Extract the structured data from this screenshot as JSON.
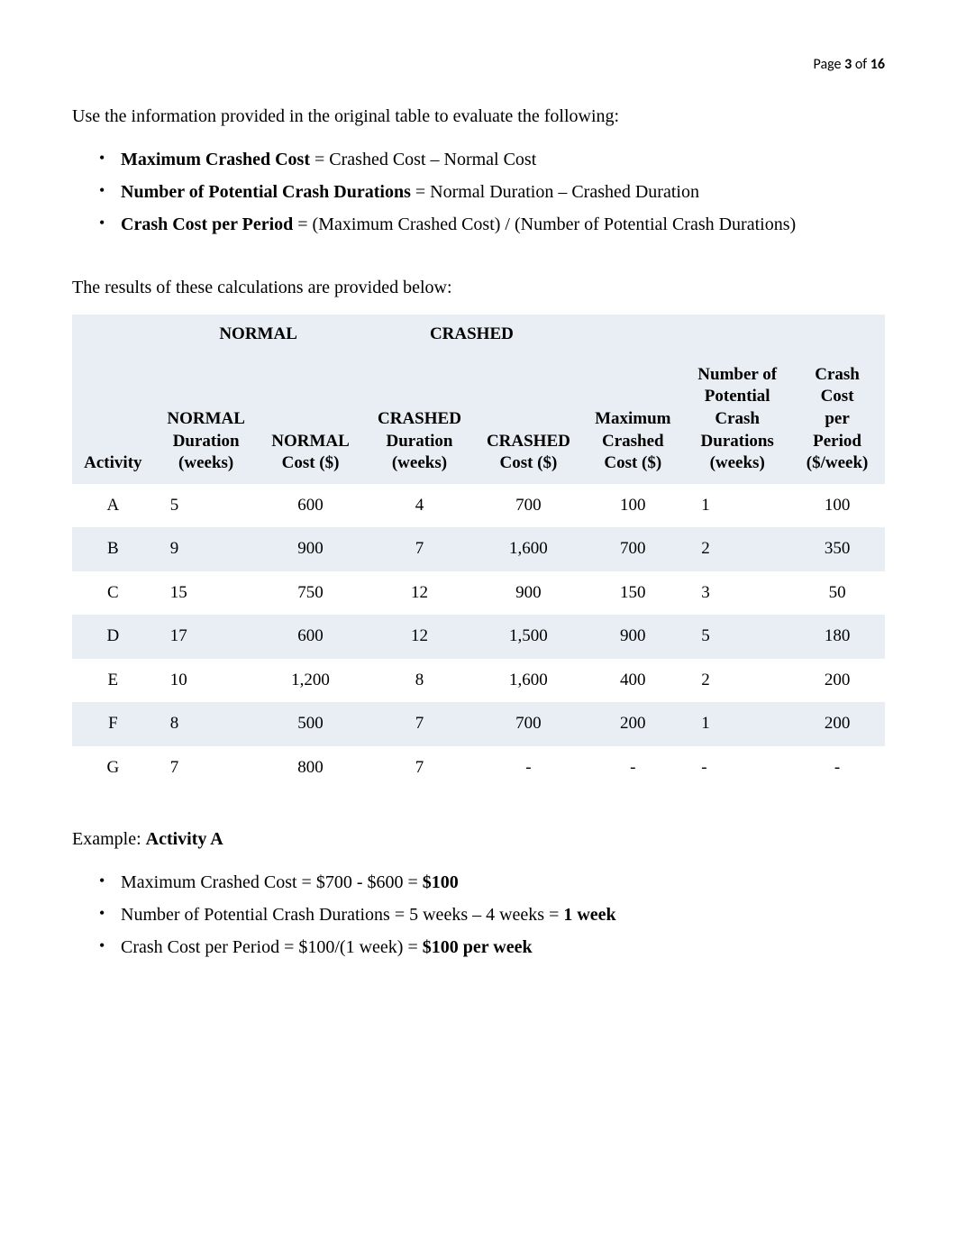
{
  "page": {
    "label": "Page ",
    "current": "3",
    "of": " of ",
    "total": "16"
  },
  "intro": "Use the information provided in the original table to evaluate the following:",
  "formulas": [
    {
      "term": "Maximum Crashed Cost",
      "def": " = Crashed Cost – Normal Cost"
    },
    {
      "term": "Number of Potential Crash Durations",
      "def": " = Normal Duration – Crashed Duration"
    },
    {
      "term": "Crash Cost per Period",
      "def": " = (Maximum Crashed Cost) / (Number of Potential Crash Durations)"
    }
  ],
  "results_text": "The results of these calculations are provided below:",
  "table": {
    "group_headers": {
      "normal": "NORMAL",
      "crashed": "CRASHED"
    },
    "headers": {
      "activity": "Activity",
      "normal_duration": "NORMAL\nDuration\n(weeks)",
      "normal_cost": "NORMAL\nCost ($)",
      "crashed_duration": "CRASHED\nDuration\n(weeks)",
      "crashed_cost": "CRASHED\nCost ($)",
      "max_crashed": "Maximum\nCrashed\nCost ($)",
      "num_potential": "Number of\nPotential\nCrash\nDurations\n(weeks)",
      "crash_cost_per": "Crash\nCost\nper\nPeriod\n($/week)"
    },
    "rows": [
      {
        "activity": "A",
        "norm_dur": "5",
        "norm_cost": "600",
        "crash_dur": "4",
        "crash_cost": "700",
        "max_crash": "100",
        "num_pot": "1",
        "crash_per": "100"
      },
      {
        "activity": "B",
        "norm_dur": "9",
        "norm_cost": "900",
        "crash_dur": "7",
        "crash_cost": "1,600",
        "max_crash": "700",
        "num_pot": "2",
        "crash_per": "350"
      },
      {
        "activity": "C",
        "norm_dur": "15",
        "norm_cost": "750",
        "crash_dur": "12",
        "crash_cost": "900",
        "max_crash": "150",
        "num_pot": "3",
        "crash_per": "50"
      },
      {
        "activity": "D",
        "norm_dur": "17",
        "norm_cost": "600",
        "crash_dur": "12",
        "crash_cost": "1,500",
        "max_crash": "900",
        "num_pot": "5",
        "crash_per": "180"
      },
      {
        "activity": "E",
        "norm_dur": "10",
        "norm_cost": "1,200",
        "crash_dur": "8",
        "crash_cost": "1,600",
        "max_crash": "400",
        "num_pot": "2",
        "crash_per": "200"
      },
      {
        "activity": "F",
        "norm_dur": "8",
        "norm_cost": "500",
        "crash_dur": "7",
        "crash_cost": "700",
        "max_crash": "200",
        "num_pot": "1",
        "crash_per": "200"
      },
      {
        "activity": "G",
        "norm_dur": "7",
        "norm_cost": "800",
        "crash_dur": "7",
        "crash_cost": "-",
        "max_crash": "-",
        "num_pot": "-",
        "crash_per": "-"
      }
    ]
  },
  "example": {
    "heading_prefix": "Example: ",
    "heading_bold": "Activity A",
    "items": [
      {
        "text": "Maximum Crashed Cost = $700 - $600 = ",
        "bold": "$100"
      },
      {
        "text": "Number of Potential Crash Durations = 5 weeks – 4 weeks = ",
        "bold": "1 week"
      },
      {
        "text": "Crash Cost per Period = $100/(1 week) = ",
        "bold": "$100 per week"
      }
    ]
  },
  "chart_data": {
    "type": "table",
    "title": "Crash Cost Calculations",
    "columns": [
      "Activity",
      "NORMAL Duration (weeks)",
      "NORMAL Cost ($)",
      "CRASHED Duration (weeks)",
      "CRASHED Cost ($)",
      "Maximum Crashed Cost ($)",
      "Number of Potential Crash Durations (weeks)",
      "Crash Cost per Period ($/week)"
    ],
    "data": [
      [
        "A",
        5,
        600,
        4,
        700,
        100,
        1,
        100
      ],
      [
        "B",
        9,
        900,
        7,
        1600,
        700,
        2,
        350
      ],
      [
        "C",
        15,
        750,
        12,
        900,
        150,
        3,
        50
      ],
      [
        "D",
        17,
        600,
        12,
        1500,
        900,
        5,
        180
      ],
      [
        "E",
        10,
        1200,
        8,
        1600,
        400,
        2,
        200
      ],
      [
        "F",
        8,
        500,
        7,
        700,
        200,
        1,
        200
      ],
      [
        "G",
        7,
        800,
        7,
        null,
        null,
        null,
        null
      ]
    ]
  }
}
